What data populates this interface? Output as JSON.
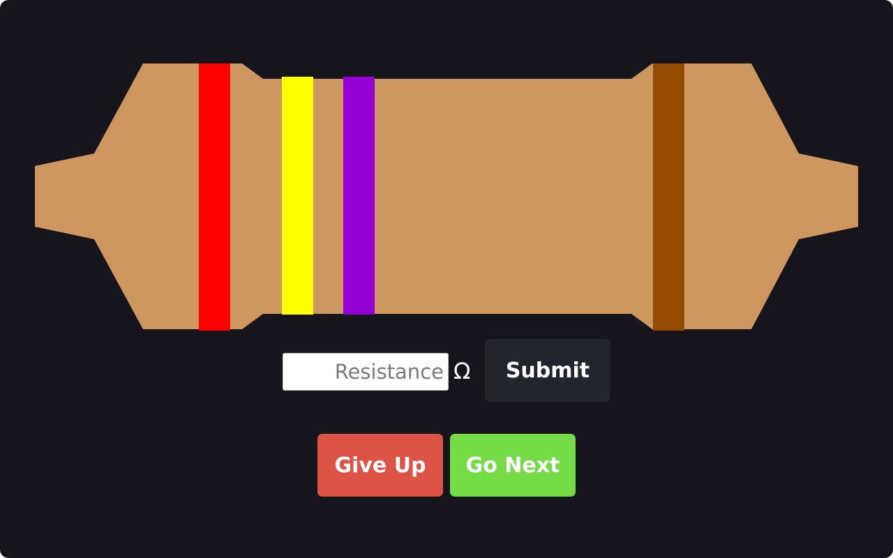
{
  "resistor": {
    "body_color": "#ce975f",
    "bands": [
      {
        "name": "red",
        "color": "#ff0000"
      },
      {
        "name": "yellow",
        "color": "#ffff00"
      },
      {
        "name": "violet",
        "color": "#9400d3"
      },
      {
        "name": "brown",
        "color": "#944a00"
      }
    ]
  },
  "answer": {
    "placeholder": "Resistance",
    "value": "",
    "unit": "Ω",
    "submit_label": "Submit"
  },
  "actions": {
    "give_up_label": "Give Up",
    "go_next_label": "Go Next"
  },
  "colors": {
    "background": "#15151b",
    "submit": "#23252c",
    "give_up": "#dd5446",
    "go_next": "#74dd46"
  }
}
